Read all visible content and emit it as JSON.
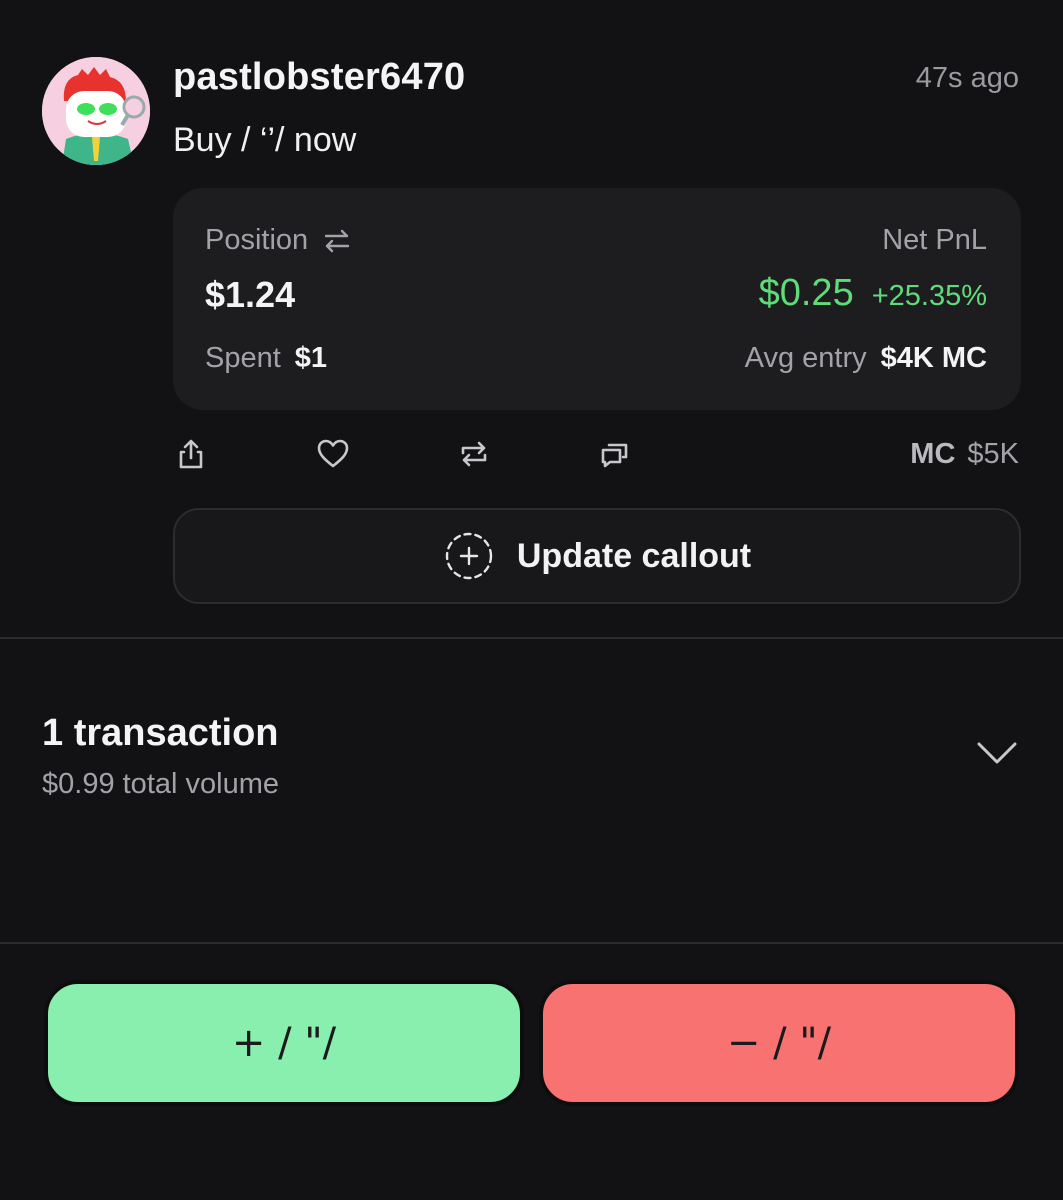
{
  "post": {
    "username": "pastlobster6470",
    "timestamp": "47s ago",
    "action_text": "Buy / ‘’/ now",
    "avatar_icon": "lobster-avatar-icon"
  },
  "position_card": {
    "position_label": "Position",
    "position_value": "$1.24",
    "net_pnl_label": "Net PnL",
    "net_pnl_value": "$0.25",
    "net_pnl_percent": "+25.35%",
    "spent_label": "Spent",
    "spent_value": "$1",
    "avg_entry_label": "Avg entry",
    "avg_entry_value": "$4K MC",
    "profit_color": "#5fdc7a"
  },
  "actions": {
    "icons": [
      "share-icon",
      "heart-icon",
      "repost-icon",
      "comment-icon"
    ],
    "mc_label": "MC",
    "mc_value": "$5K"
  },
  "update_button": {
    "label": "Update callout",
    "icon": "dashed-plus-icon"
  },
  "transactions": {
    "title": "1 transaction",
    "subtitle": "$0.99 total volume",
    "icon": "chevron-down-icon"
  },
  "trade_buttons": {
    "buy_label": "+ / \"/",
    "sell_label": "− / \"/",
    "buy_color": "#89efae",
    "sell_color": "#f97272"
  }
}
